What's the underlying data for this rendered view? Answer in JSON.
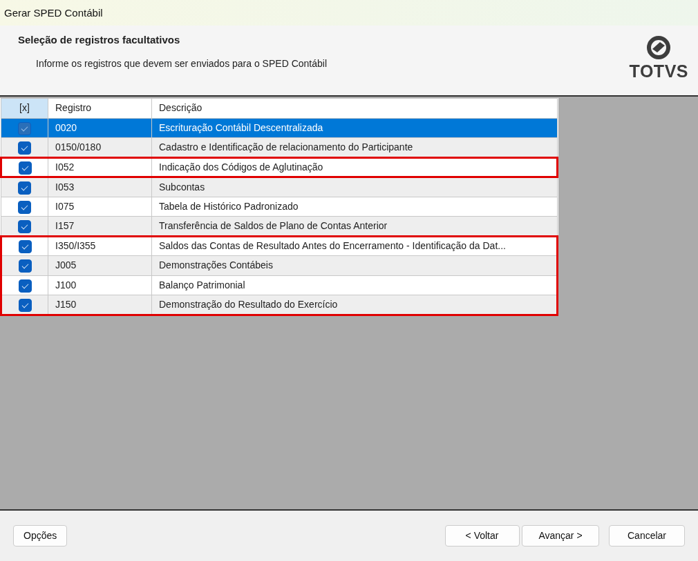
{
  "window": {
    "title": "Gerar SPED Contábil"
  },
  "header": {
    "title": "Seleção de registros facultativos",
    "subtitle": "Informe os registros que devem ser enviados para o SPED Contábil",
    "logo_text": "TOTVS"
  },
  "table": {
    "columns": [
      "[x]",
      "Registro",
      "Descrição"
    ],
    "rows": [
      {
        "checked": true,
        "selected": true,
        "highlighted": false,
        "registro": "0020",
        "descricao": "Escrituração Contábil Descentralizada"
      },
      {
        "checked": true,
        "selected": false,
        "highlighted": false,
        "registro": "0150/0180",
        "descricao": "Cadastro e Identificação de relacionamento do Participante"
      },
      {
        "checked": true,
        "selected": false,
        "highlighted": true,
        "registro": "I052",
        "descricao": "Indicação dos Códigos de Aglutinação"
      },
      {
        "checked": true,
        "selected": false,
        "highlighted": false,
        "registro": "I053",
        "descricao": "Subcontas"
      },
      {
        "checked": true,
        "selected": false,
        "highlighted": false,
        "registro": "I075",
        "descricao": "Tabela de Histórico Padronizado"
      },
      {
        "checked": true,
        "selected": false,
        "highlighted": false,
        "registro": "I157",
        "descricao": "Transferência de Saldos de Plano de Contas Anterior"
      },
      {
        "checked": true,
        "selected": false,
        "highlighted": true,
        "registro": "I350/I355",
        "descricao": "Saldos das Contas de Resultado Antes do Encerramento - Identificação da Dat..."
      },
      {
        "checked": true,
        "selected": false,
        "highlighted": true,
        "registro": "J005",
        "descricao": "Demonstrações Contábeis"
      },
      {
        "checked": true,
        "selected": false,
        "highlighted": true,
        "registro": "J100",
        "descricao": "Balanço Patrimonial"
      },
      {
        "checked": true,
        "selected": false,
        "highlighted": true,
        "registro": "J150",
        "descricao": "Demonstração do Resultado do Exercício"
      }
    ]
  },
  "footer": {
    "options_button": "Opções",
    "back_button": "< Voltar",
    "next_button": "Avançar >",
    "cancel_button": "Cancelar"
  }
}
